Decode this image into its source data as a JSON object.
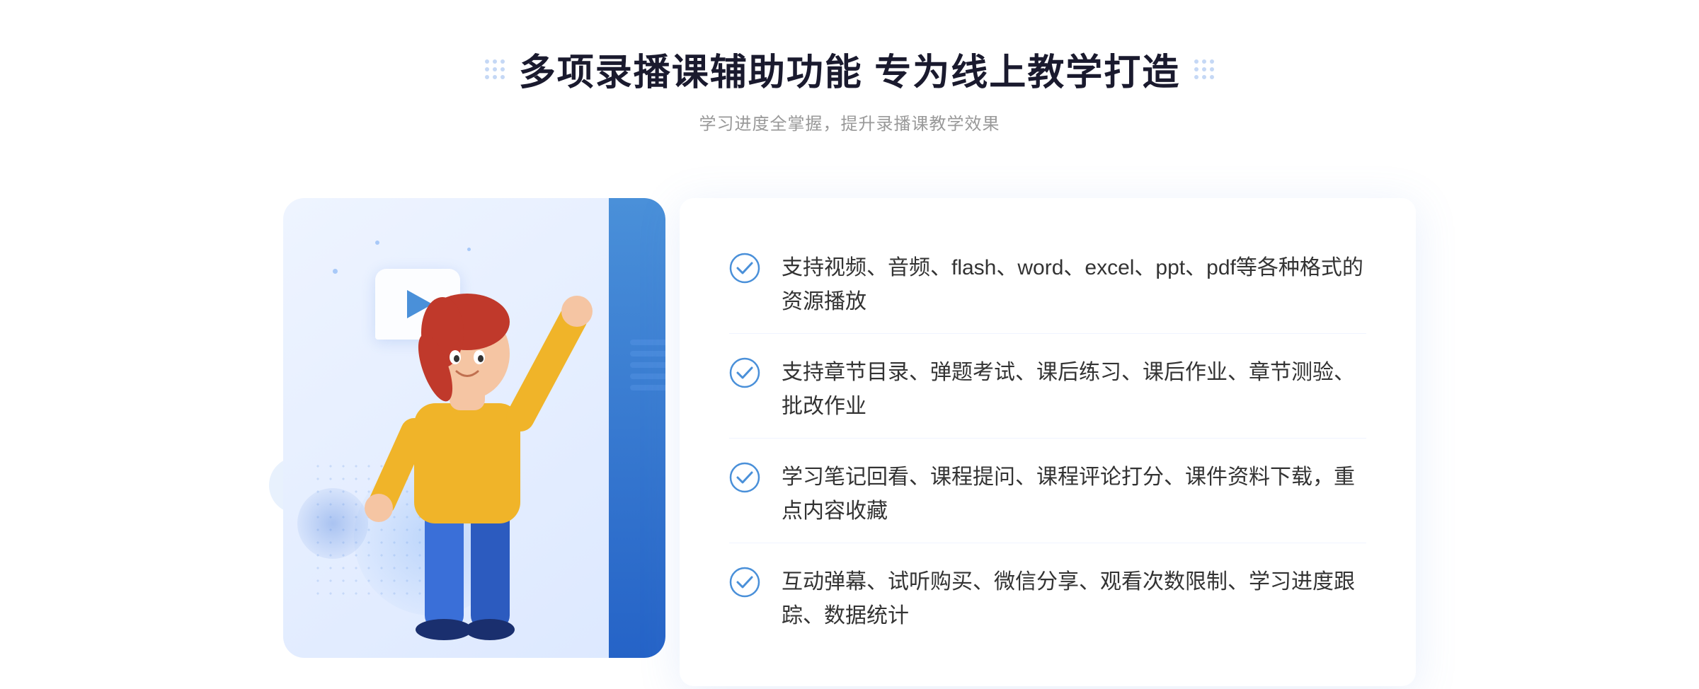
{
  "header": {
    "title": "多项录播课辅助功能 专为线上教学打造",
    "subtitle": "学习进度全掌握，提升录播课教学效果"
  },
  "features": [
    {
      "id": "feature-1",
      "text": "支持视频、音频、flash、word、excel、ppt、pdf等各种格式的资源播放"
    },
    {
      "id": "feature-2",
      "text": "支持章节目录、弹题考试、课后练习、课后作业、章节测验、批改作业"
    },
    {
      "id": "feature-3",
      "text": "学习笔记回看、课程提问、课程评论打分、课件资料下载，重点内容收藏"
    },
    {
      "id": "feature-4",
      "text": "互动弹幕、试听购买、微信分享、观看次数限制、学习进度跟踪、数据统计"
    }
  ],
  "colors": {
    "primary": "#4a90d9",
    "primary_dark": "#2563c7",
    "check_color": "#4a90d9",
    "title_color": "#1a1a2e",
    "text_color": "#333333",
    "subtitle_color": "#999999"
  }
}
